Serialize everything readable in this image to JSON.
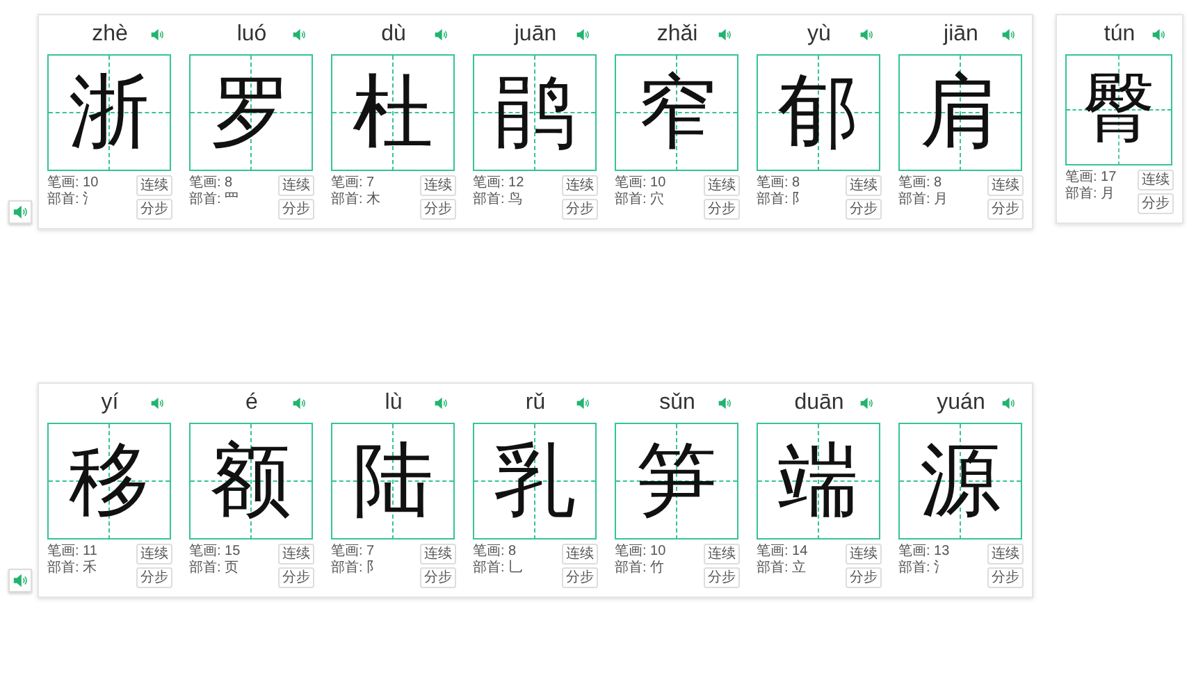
{
  "rows": [
    {
      "groups": [
        {
          "cells": [
            {
              "pinyin": "zhè",
              "char": "浙",
              "strokes": "笔画: 10",
              "radical": "部首: 氵",
              "buttons": [
                "连续",
                "分步"
              ]
            },
            {
              "pinyin": "luó",
              "char": "罗",
              "strokes": "笔画: 8",
              "radical": "部首: 罒",
              "buttons": [
                "连续",
                "分步"
              ]
            },
            {
              "pinyin": "dù",
              "char": "杜",
              "strokes": "笔画: 7",
              "radical": "部首: 木",
              "buttons": [
                "连续",
                "分步"
              ]
            },
            {
              "pinyin": "juān",
              "char": "鹃",
              "strokes": "笔画: 12",
              "radical": "部首: 鸟",
              "buttons": [
                "连续",
                "分步"
              ]
            },
            {
              "pinyin": "zhǎi",
              "char": "窄",
              "strokes": "笔画: 10",
              "radical": "部首: 穴",
              "buttons": [
                "连续",
                "分步"
              ]
            },
            {
              "pinyin": "yù",
              "char": "郁",
              "strokes": "笔画: 8",
              "radical": "部首: 阝",
              "buttons": [
                "连续",
                "分步"
              ]
            },
            {
              "pinyin": "jiān",
              "char": "肩",
              "strokes": "笔画: 8",
              "radical": "部首: 月",
              "buttons": [
                "连续",
                "分步"
              ]
            }
          ]
        },
        {
          "cells": [
            {
              "pinyin": "tún",
              "char": "臀",
              "strokes": "笔画: 17",
              "radical": "部首: 月",
              "buttons": [
                "连续",
                "分步"
              ]
            }
          ]
        }
      ]
    },
    {
      "groups": [
        {
          "cells": [
            {
              "pinyin": "yí",
              "char": "移",
              "strokes": "笔画: 11",
              "radical": "部首: 禾",
              "buttons": [
                "连续",
                "分步"
              ]
            },
            {
              "pinyin": "é",
              "char": "额",
              "strokes": "笔画: 15",
              "radical": "部首: 页",
              "buttons": [
                "连续",
                "分步"
              ]
            },
            {
              "pinyin": "lù",
              "char": "陆",
              "strokes": "笔画: 7",
              "radical": "部首: 阝",
              "buttons": [
                "连续",
                "分步"
              ]
            },
            {
              "pinyin": "rǔ",
              "char": "乳",
              "strokes": "笔画: 8",
              "radical": "部首: 乚",
              "buttons": [
                "连续",
                "分步"
              ]
            },
            {
              "pinyin": "sǔn",
              "char": "笋",
              "strokes": "笔画: 10",
              "radical": "部首: 竹",
              "buttons": [
                "连续",
                "分步"
              ]
            },
            {
              "pinyin": "duān",
              "char": "端",
              "strokes": "笔画: 14",
              "radical": "部首: 立",
              "buttons": [
                "连续",
                "分步"
              ]
            },
            {
              "pinyin": "yuán",
              "char": "源",
              "strokes": "笔画: 13",
              "radical": "部首: 氵",
              "buttons": [
                "连续",
                "分步"
              ]
            }
          ]
        }
      ]
    }
  ]
}
